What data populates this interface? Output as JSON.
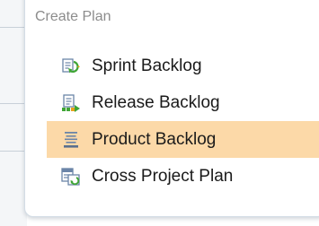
{
  "menu": {
    "header": "Create Plan",
    "items": [
      {
        "label": "Sprint Backlog",
        "icon": "sprint-backlog-icon",
        "selected": false
      },
      {
        "label": "Release Backlog",
        "icon": "release-backlog-icon",
        "selected": false
      },
      {
        "label": "Product Backlog",
        "icon": "product-backlog-icon",
        "selected": true
      },
      {
        "label": "Cross Project Plan",
        "icon": "cross-project-plan-icon",
        "selected": false
      }
    ]
  },
  "colors": {
    "selected_background": "#fcd9a8",
    "header_text": "#8c8c8c",
    "item_text": "#1a1a1a"
  }
}
